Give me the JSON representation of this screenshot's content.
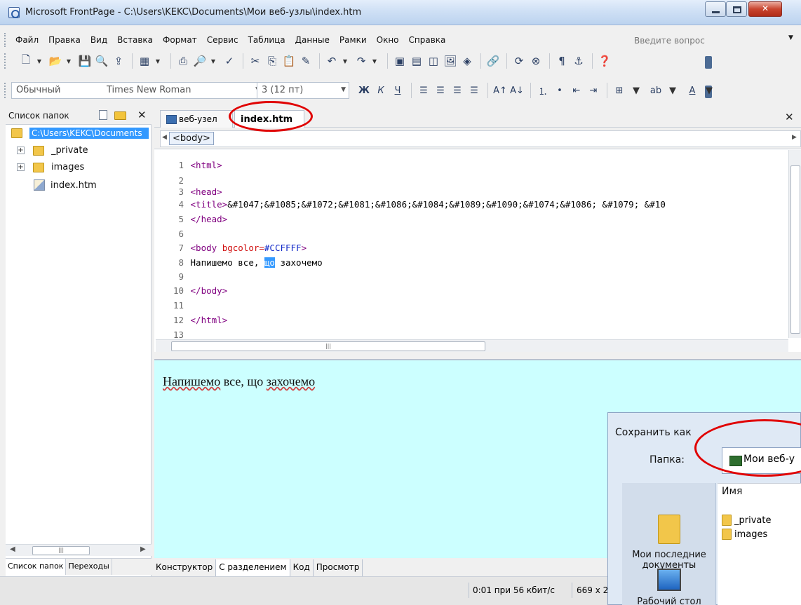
{
  "window": {
    "title": "Microsoft FrontPage - C:\\Users\\KEKC\\Documents\\Мои веб-узлы\\index.htm"
  },
  "menu": {
    "items": [
      {
        "label": "Файл"
      },
      {
        "label": "Правка"
      },
      {
        "label": "Вид"
      },
      {
        "label": "Вставка"
      },
      {
        "label": "Формат"
      },
      {
        "label": "Сервис"
      },
      {
        "label": "Таблица"
      },
      {
        "label": "Данные"
      },
      {
        "label": "Рамки"
      },
      {
        "label": "Окно"
      },
      {
        "label": "Справка"
      }
    ],
    "help_placeholder": "Введите вопрос"
  },
  "format_toolbar": {
    "style": "Обычный",
    "font": "Times New Roman",
    "size": "3 (12 пт)"
  },
  "folder_panel": {
    "title": "Список папок",
    "root": "C:\\Users\\KEKC\\Documents",
    "folders": [
      "_private",
      "images"
    ],
    "file": "index.htm",
    "tabs": [
      "Список папок",
      "Переходы"
    ]
  },
  "doc_tabs": {
    "site_tab": "веб-узел",
    "file_tab": "index.htm"
  },
  "tag_selector": {
    "tag": "<body>"
  },
  "code_lines": [
    {
      "num": "1",
      "tag1": "<html>"
    },
    {
      "num": "2"
    },
    {
      "num": "3",
      "tag1": "<head>"
    },
    {
      "num": "4",
      "tag1": "<title>",
      "text": "&#1047;&#1085;&#1072;&#1081;&#1086;&#1084;&#1089;&#1090;&#1074;&#1086; &#1079; &#10"
    },
    {
      "num": "5",
      "tag1": "</head>"
    },
    {
      "num": "6"
    },
    {
      "num": "7",
      "tag1": "<body ",
      "attr": "bgcolor=",
      "val": "#CCFFFF",
      "tag2": ">"
    },
    {
      "num": "8",
      "text_before": "Напишемо все, ",
      "selected": "що",
      "text_after": " захочемо"
    },
    {
      "num": "9"
    },
    {
      "num": "10",
      "tag1": "</body>"
    },
    {
      "num": "11"
    },
    {
      "num": "12",
      "tag1": "</html>"
    },
    {
      "num": "13"
    }
  ],
  "design": {
    "text": "Напишемо все, що захочемо",
    "text_part1": "Напишемо",
    "text_part2": " все, що ",
    "text_part3": "захочемо"
  },
  "view_tabs": [
    "Конструктор",
    "С разделением",
    "Код",
    "Просмотр"
  ],
  "status": {
    "speed": "0:01 при 56 кбит/с",
    "size": "669 x 2"
  },
  "save_dialog": {
    "title": "Сохранить как",
    "folder_label": "Папка:",
    "folder_value": "Мои веб-у",
    "column_name": "Имя",
    "places": [
      "Мои последние документы",
      "Рабочий стол"
    ],
    "files": [
      "_private",
      "images"
    ]
  },
  "colors": {
    "design_background": "#CCFFFF",
    "annotation": "#e00000",
    "selection": "#3399ff"
  }
}
